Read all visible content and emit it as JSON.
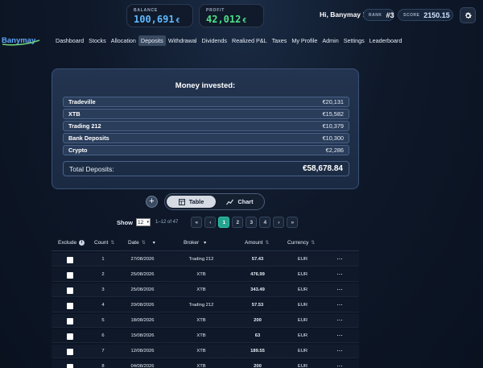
{
  "header": {
    "balance": {
      "label": "BALANCE",
      "value": "100,691",
      "currency": "€"
    },
    "profit": {
      "label": "PROFIT",
      "value": "42,012",
      "currency": "€"
    },
    "greeting": "Hi, Banymay !",
    "rank": {
      "label": "RANK",
      "value": "#3"
    },
    "score": {
      "label": "SCORE",
      "value": "2150.15"
    },
    "logo_text": "Banymay",
    "colors": {
      "balance": "#5fb9ff",
      "profit": "#4ee08a"
    }
  },
  "nav": {
    "items": [
      "Dashboard",
      "Stocks",
      "Allocation",
      "Deposits",
      "Withdrawal",
      "Dividends",
      "Realized P&L",
      "Taxes",
      "My Profile",
      "Admin",
      "Settings",
      "Leaderboard"
    ],
    "active": "Deposits"
  },
  "invested": {
    "title": "Money invested:",
    "brokers": [
      {
        "name": "Tradeville",
        "amount": "€20,131"
      },
      {
        "name": "XTB",
        "amount": "€15,582"
      },
      {
        "name": "Trading 212",
        "amount": "€10,379"
      },
      {
        "name": "Bank Deposits",
        "amount": "€10,300"
      },
      {
        "name": "Crypto",
        "amount": "€2,286"
      }
    ],
    "total_label": "Total Deposits:",
    "total_amount": "€58,678.84"
  },
  "view_toggle": {
    "table_label": "Table",
    "chart_label": "Chart",
    "selected": "Table"
  },
  "pagination": {
    "show_label": "Show",
    "page_size": "12",
    "range_text": "1–12 of 47",
    "pages": [
      "1",
      "2",
      "3",
      "4"
    ],
    "current_page": "1",
    "controls": {
      "first": "«",
      "prev": "‹",
      "next": "›",
      "last": "»"
    }
  },
  "table": {
    "columns": [
      "Exclude",
      "Count",
      "Date",
      "Broker",
      "Amount",
      "Currency"
    ],
    "rows": [
      {
        "count": "1",
        "date": "27/08/2026",
        "broker": "Trading 212",
        "amount": "57.43",
        "currency": "EUR"
      },
      {
        "count": "2",
        "date": "25/08/2026",
        "broker": "XTB",
        "amount": "476.99",
        "currency": "EUR"
      },
      {
        "count": "3",
        "date": "25/08/2026",
        "broker": "XTB",
        "amount": "343.49",
        "currency": "EUR"
      },
      {
        "count": "4",
        "date": "20/08/2026",
        "broker": "Trading 212",
        "amount": "57.53",
        "currency": "EUR"
      },
      {
        "count": "5",
        "date": "18/08/2026",
        "broker": "XTB",
        "amount": "200",
        "currency": "EUR"
      },
      {
        "count": "6",
        "date": "15/08/2026",
        "broker": "XTB",
        "amount": "63",
        "currency": "EUR"
      },
      {
        "count": "7",
        "date": "12/08/2026",
        "broker": "XTB",
        "amount": "189.55",
        "currency": "EUR"
      },
      {
        "count": "8",
        "date": "04/08/2026",
        "broker": "XTB",
        "amount": "200",
        "currency": "EUR"
      }
    ]
  }
}
